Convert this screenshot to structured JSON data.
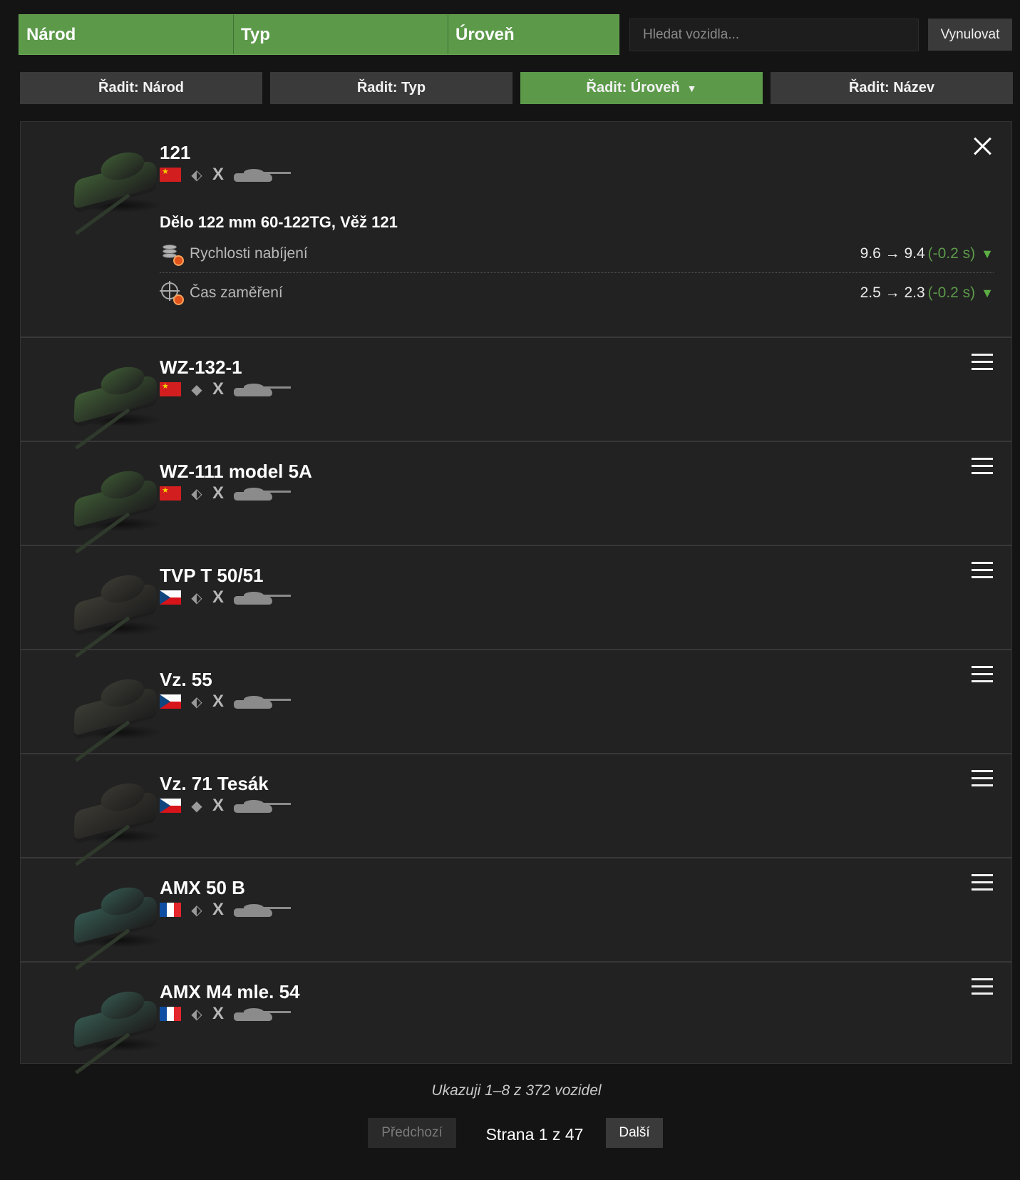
{
  "filters": {
    "nation_label": "Národ",
    "type_label": "Typ",
    "tier_label": "Úroveň"
  },
  "search": {
    "placeholder": "Hledat vozidla...",
    "reset_label": "Vynulovat"
  },
  "sort": {
    "nation": "Řadit: Národ",
    "type": "Řadit: Typ",
    "tier": "Řadit: Úroveň",
    "tier_arrow": "▼",
    "name": "Řadit: Název",
    "active": "tier"
  },
  "colors": {
    "accent": "#5c9a4a",
    "panel": "#222222",
    "positive_delta": "#5c9a4a"
  },
  "vehicles": [
    {
      "name": "121",
      "nation": "china",
      "role_icon": "double-diamond-icon",
      "tier": "X",
      "camo": "#3e5a34",
      "expanded": true
    },
    {
      "name": "WZ-132-1",
      "nation": "china",
      "role_icon": "diamond-icon",
      "tier": "X",
      "camo": "#3f5b35"
    },
    {
      "name": "WZ-111 model 5A",
      "nation": "china",
      "role_icon": "double-diamond-icon",
      "tier": "X",
      "camo": "#3c5633"
    },
    {
      "name": "TVP T 50/51",
      "nation": "czech",
      "role_icon": "double-diamond-icon",
      "tier": "X",
      "camo": "#3c3b33"
    },
    {
      "name": "Vz. 55",
      "nation": "czech",
      "role_icon": "double-diamond-icon",
      "tier": "X",
      "camo": "#3b3b34"
    },
    {
      "name": "Vz. 71 Tesák",
      "nation": "czech",
      "role_icon": "diamond-icon",
      "tier": "X",
      "camo": "#3a3831"
    },
    {
      "name": "AMX 50 B",
      "nation": "france",
      "role_icon": "double-diamond-icon",
      "tier": "X",
      "camo": "#34574f"
    },
    {
      "name": "AMX M4 mle. 54",
      "nation": "france",
      "role_icon": "double-diamond-icon",
      "tier": "X",
      "camo": "#35564c"
    }
  ],
  "upgrade": {
    "title": "Dělo 122 mm 60-122TG, Věž 121",
    "stats": [
      {
        "label": "Rychlosti nabíjení",
        "icon": "reload-icon",
        "from": "9.6",
        "arrow": "→",
        "to": "9.4",
        "delta": "(-0.2 s)",
        "trend": "▼"
      },
      {
        "label": "Čas zaměření",
        "icon": "aim-icon",
        "from": "2.5",
        "arrow": "→",
        "to": "2.3",
        "delta": "(-0.2 s)",
        "trend": "▼"
      }
    ]
  },
  "pagination": {
    "summary": "Ukazuji 1–8 z 372 vozidel",
    "prev_label": "Předchozí",
    "page_label": "Strana 1 z 47",
    "next_label": "Další"
  }
}
